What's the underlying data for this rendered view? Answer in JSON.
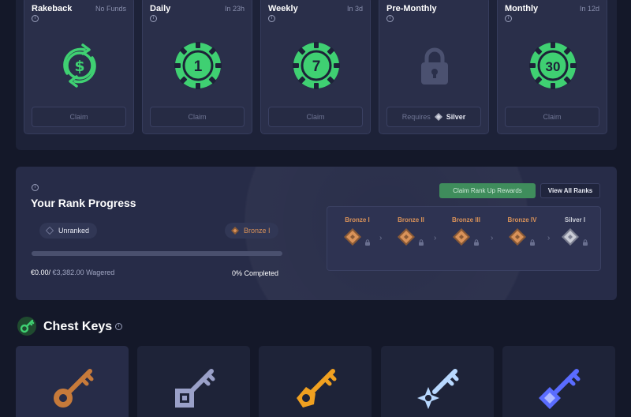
{
  "rewards": [
    {
      "title": "Rakeback",
      "status": "No Funds",
      "info": "i",
      "button": "Claim",
      "icon": "rakeback-dollar-icon"
    },
    {
      "title": "Daily",
      "status": "In 23h",
      "info": "i",
      "chip_value": "1",
      "button": "Claim",
      "icon": "chip-icon"
    },
    {
      "title": "Weekly",
      "status": "In 3d",
      "info": "i",
      "chip_value": "7",
      "button": "Claim",
      "icon": "chip-icon"
    },
    {
      "title": "Pre-Monthly",
      "status": "",
      "info": "i",
      "button_prefix": "Requires",
      "button_rank": "Silver",
      "icon": "lock-icon"
    },
    {
      "title": "Monthly",
      "status": "In 12d",
      "info": "i",
      "chip_value": "30",
      "button": "Claim",
      "icon": "chip-icon"
    }
  ],
  "rank": {
    "info": "i",
    "title": "Your Rank Progress",
    "claim_button": "Claim Rank Up Rewards",
    "view_button": "View All Ranks",
    "current": "Unranked",
    "next": "Bronze I",
    "progress": 0,
    "wagered_current": "€0.00/",
    "wagered_target": "€3,382.00",
    "wagered_suffix": "Wagered",
    "completed": "0% Completed",
    "tiers": [
      {
        "name": "Bronze I",
        "color": "#d99259"
      },
      {
        "name": "Bronze II",
        "color": "#d99259"
      },
      {
        "name": "Bronze III",
        "color": "#d99259"
      },
      {
        "name": "Bronze IV",
        "color": "#d99259"
      },
      {
        "name": "Silver I",
        "color": "#c9ccd6"
      }
    ]
  },
  "chest_keys": {
    "title": "Chest Keys",
    "info": "i",
    "keys": [
      {
        "name": "bronze-key-icon",
        "color": "#c77a3a"
      },
      {
        "name": "silver-key-icon",
        "color": "#9aa0c8"
      },
      {
        "name": "gold-key-icon",
        "color": "#f0a020"
      },
      {
        "name": "platinum-key-icon",
        "color": "#b8d8ff"
      },
      {
        "name": "diamond-key-icon",
        "color": "#5a6cff"
      }
    ]
  },
  "colors": {
    "accent_green": "#3fd072",
    "bronze": "#d99259",
    "silver": "#c9ccd6"
  }
}
